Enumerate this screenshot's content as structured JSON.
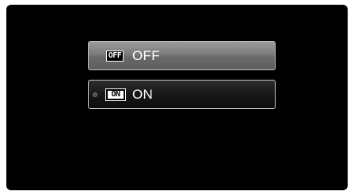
{
  "menu": {
    "options": [
      {
        "badge": "OFF",
        "label": "OFF",
        "icon": "off-badge-icon",
        "selected": false
      },
      {
        "badge": "ON",
        "label": "ON",
        "icon": "on-badge-icon",
        "selected": true
      }
    ]
  },
  "colors": {
    "screen_background": "#000000",
    "off_button": "#7c7c7c",
    "on_button": "#181818",
    "text": "#ffffff"
  }
}
